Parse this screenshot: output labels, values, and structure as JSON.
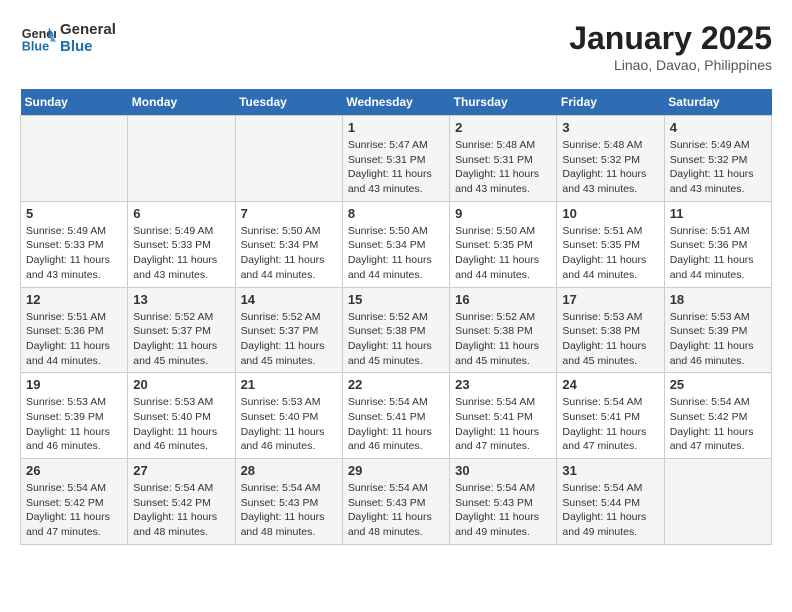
{
  "header": {
    "logo_line1": "General",
    "logo_line2": "Blue",
    "title": "January 2025",
    "subtitle": "Linao, Davao, Philippines"
  },
  "weekdays": [
    "Sunday",
    "Monday",
    "Tuesday",
    "Wednesday",
    "Thursday",
    "Friday",
    "Saturday"
  ],
  "weeks": [
    [
      {
        "day": "",
        "text": ""
      },
      {
        "day": "",
        "text": ""
      },
      {
        "day": "",
        "text": ""
      },
      {
        "day": "1",
        "text": "Sunrise: 5:47 AM\nSunset: 5:31 PM\nDaylight: 11 hours\nand 43 minutes."
      },
      {
        "day": "2",
        "text": "Sunrise: 5:48 AM\nSunset: 5:31 PM\nDaylight: 11 hours\nand 43 minutes."
      },
      {
        "day": "3",
        "text": "Sunrise: 5:48 AM\nSunset: 5:32 PM\nDaylight: 11 hours\nand 43 minutes."
      },
      {
        "day": "4",
        "text": "Sunrise: 5:49 AM\nSunset: 5:32 PM\nDaylight: 11 hours\nand 43 minutes."
      }
    ],
    [
      {
        "day": "5",
        "text": "Sunrise: 5:49 AM\nSunset: 5:33 PM\nDaylight: 11 hours\nand 43 minutes."
      },
      {
        "day": "6",
        "text": "Sunrise: 5:49 AM\nSunset: 5:33 PM\nDaylight: 11 hours\nand 43 minutes."
      },
      {
        "day": "7",
        "text": "Sunrise: 5:50 AM\nSunset: 5:34 PM\nDaylight: 11 hours\nand 44 minutes."
      },
      {
        "day": "8",
        "text": "Sunrise: 5:50 AM\nSunset: 5:34 PM\nDaylight: 11 hours\nand 44 minutes."
      },
      {
        "day": "9",
        "text": "Sunrise: 5:50 AM\nSunset: 5:35 PM\nDaylight: 11 hours\nand 44 minutes."
      },
      {
        "day": "10",
        "text": "Sunrise: 5:51 AM\nSunset: 5:35 PM\nDaylight: 11 hours\nand 44 minutes."
      },
      {
        "day": "11",
        "text": "Sunrise: 5:51 AM\nSunset: 5:36 PM\nDaylight: 11 hours\nand 44 minutes."
      }
    ],
    [
      {
        "day": "12",
        "text": "Sunrise: 5:51 AM\nSunset: 5:36 PM\nDaylight: 11 hours\nand 44 minutes."
      },
      {
        "day": "13",
        "text": "Sunrise: 5:52 AM\nSunset: 5:37 PM\nDaylight: 11 hours\nand 45 minutes."
      },
      {
        "day": "14",
        "text": "Sunrise: 5:52 AM\nSunset: 5:37 PM\nDaylight: 11 hours\nand 45 minutes."
      },
      {
        "day": "15",
        "text": "Sunrise: 5:52 AM\nSunset: 5:38 PM\nDaylight: 11 hours\nand 45 minutes."
      },
      {
        "day": "16",
        "text": "Sunrise: 5:52 AM\nSunset: 5:38 PM\nDaylight: 11 hours\nand 45 minutes."
      },
      {
        "day": "17",
        "text": "Sunrise: 5:53 AM\nSunset: 5:38 PM\nDaylight: 11 hours\nand 45 minutes."
      },
      {
        "day": "18",
        "text": "Sunrise: 5:53 AM\nSunset: 5:39 PM\nDaylight: 11 hours\nand 46 minutes."
      }
    ],
    [
      {
        "day": "19",
        "text": "Sunrise: 5:53 AM\nSunset: 5:39 PM\nDaylight: 11 hours\nand 46 minutes."
      },
      {
        "day": "20",
        "text": "Sunrise: 5:53 AM\nSunset: 5:40 PM\nDaylight: 11 hours\nand 46 minutes."
      },
      {
        "day": "21",
        "text": "Sunrise: 5:53 AM\nSunset: 5:40 PM\nDaylight: 11 hours\nand 46 minutes."
      },
      {
        "day": "22",
        "text": "Sunrise: 5:54 AM\nSunset: 5:41 PM\nDaylight: 11 hours\nand 46 minutes."
      },
      {
        "day": "23",
        "text": "Sunrise: 5:54 AM\nSunset: 5:41 PM\nDaylight: 11 hours\nand 47 minutes."
      },
      {
        "day": "24",
        "text": "Sunrise: 5:54 AM\nSunset: 5:41 PM\nDaylight: 11 hours\nand 47 minutes."
      },
      {
        "day": "25",
        "text": "Sunrise: 5:54 AM\nSunset: 5:42 PM\nDaylight: 11 hours\nand 47 minutes."
      }
    ],
    [
      {
        "day": "26",
        "text": "Sunrise: 5:54 AM\nSunset: 5:42 PM\nDaylight: 11 hours\nand 47 minutes."
      },
      {
        "day": "27",
        "text": "Sunrise: 5:54 AM\nSunset: 5:42 PM\nDaylight: 11 hours\nand 48 minutes."
      },
      {
        "day": "28",
        "text": "Sunrise: 5:54 AM\nSunset: 5:43 PM\nDaylight: 11 hours\nand 48 minutes."
      },
      {
        "day": "29",
        "text": "Sunrise: 5:54 AM\nSunset: 5:43 PM\nDaylight: 11 hours\nand 48 minutes."
      },
      {
        "day": "30",
        "text": "Sunrise: 5:54 AM\nSunset: 5:43 PM\nDaylight: 11 hours\nand 49 minutes."
      },
      {
        "day": "31",
        "text": "Sunrise: 5:54 AM\nSunset: 5:44 PM\nDaylight: 11 hours\nand 49 minutes."
      },
      {
        "day": "",
        "text": ""
      }
    ]
  ]
}
